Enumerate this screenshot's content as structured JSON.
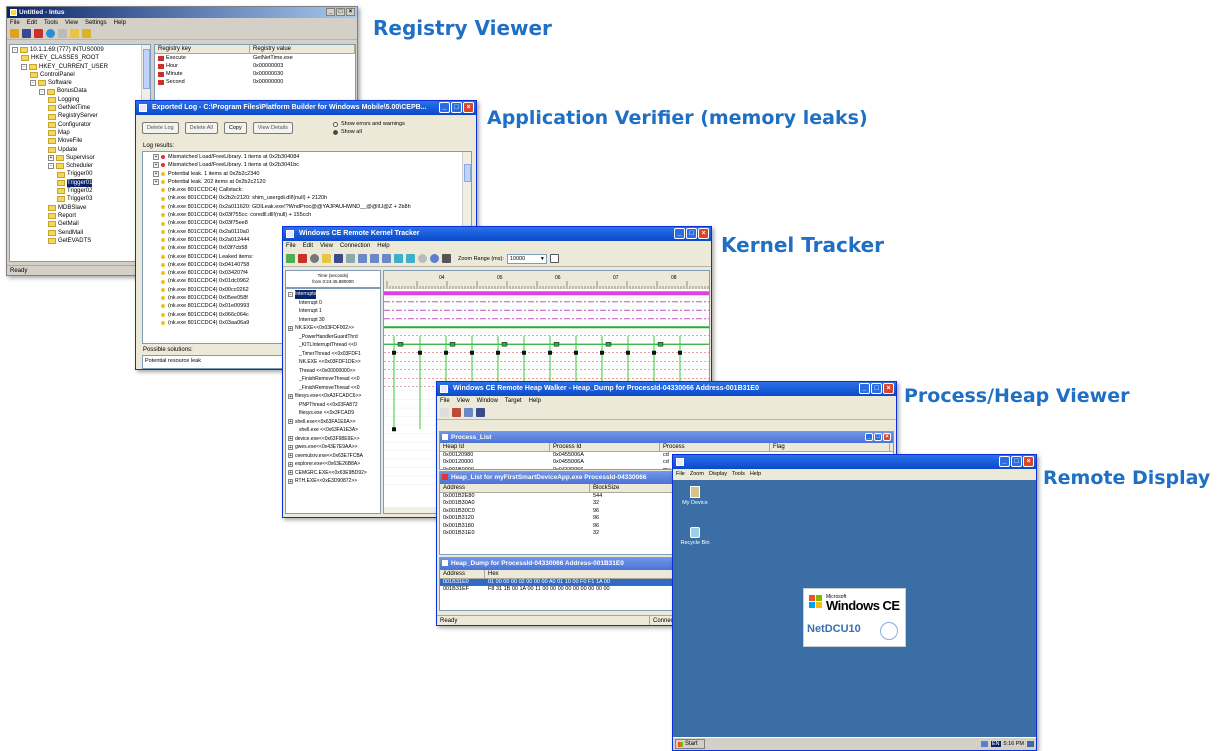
{
  "labels": {
    "registry": "Registry Viewer",
    "verifier": "Application Verifier (memory leaks)",
    "kernel": "Kernel Tracker",
    "heap": "Process/Heap Viewer",
    "remote": "Remote Display"
  },
  "colors": {
    "label_blue": "#1f6fc5",
    "xp_title": "#0a49c9",
    "desktop": "#3a6ea5"
  },
  "registry_window": {
    "title": "Untitled - Intus",
    "menu": [
      "File",
      "Edit",
      "Tools",
      "View",
      "Settings",
      "Help"
    ],
    "tree": [
      {
        "label": "10.1.1.69:(777) INTUS0009",
        "indent": 0,
        "exp": "-"
      },
      {
        "label": "HKEY_CLASSES_ROOT",
        "indent": 1,
        "exp": ""
      },
      {
        "label": "HKEY_CURRENT_USER",
        "indent": 1,
        "exp": "-"
      },
      {
        "label": "ControlPanel",
        "indent": 2,
        "exp": ""
      },
      {
        "label": "Software",
        "indent": 2,
        "exp": "-"
      },
      {
        "label": "BonusData",
        "indent": 3,
        "exp": "-"
      },
      {
        "label": "Logging",
        "indent": 4,
        "exp": ""
      },
      {
        "label": "GetNetTime",
        "indent": 4,
        "exp": ""
      },
      {
        "label": "RegistryServer",
        "indent": 4,
        "exp": ""
      },
      {
        "label": "Configurator",
        "indent": 4,
        "exp": ""
      },
      {
        "label": "Map",
        "indent": 4,
        "exp": ""
      },
      {
        "label": "MoveFile",
        "indent": 4,
        "exp": ""
      },
      {
        "label": "Update",
        "indent": 4,
        "exp": ""
      },
      {
        "label": "Supervisor",
        "indent": 4,
        "exp": "+"
      },
      {
        "label": "Scheduler",
        "indent": 4,
        "exp": "-"
      },
      {
        "label": "Trigger00",
        "indent": 5,
        "exp": ""
      },
      {
        "label": "Trigger01",
        "indent": 5,
        "exp": "",
        "selected": true
      },
      {
        "label": "Trigger02",
        "indent": 5,
        "exp": ""
      },
      {
        "label": "Trigger03",
        "indent": 5,
        "exp": ""
      },
      {
        "label": "MDBSlave",
        "indent": 4,
        "exp": ""
      },
      {
        "label": "Report",
        "indent": 4,
        "exp": ""
      },
      {
        "label": "GetMail",
        "indent": 4,
        "exp": ""
      },
      {
        "label": "SendMail",
        "indent": 4,
        "exp": ""
      },
      {
        "label": "GetEVADTS",
        "indent": 4,
        "exp": ""
      }
    ],
    "columns": [
      "Registry key",
      "Registry value"
    ],
    "values": [
      {
        "key": "Execute",
        "value": "GetNetTime.exe"
      },
      {
        "key": "Hour",
        "value": "0x00000003"
      },
      {
        "key": "Minute",
        "value": "0x00000030"
      },
      {
        "key": "Second",
        "value": "0x00000000"
      }
    ],
    "status": "Ready"
  },
  "verifier_window": {
    "title": "Exported Log - C:\\Program Files\\Platform Builder for Windows Mobile\\5.00\\CEPB...",
    "buttons": [
      "Delete Log",
      "Delete All",
      "Copy",
      "View Details"
    ],
    "radio_errors": "Show errors and warnings",
    "radio_all": "Show all",
    "log_label": "Log results:",
    "rows": [
      {
        "text": "Mismatched Load/FreeLibrary.   1 items at 0x2b304084",
        "indent": 1,
        "color": "#d33"
      },
      {
        "text": "Mismatched Load/FreeLibrary.   1 items at 0x2b3041bc",
        "indent": 1,
        "color": "#d33"
      },
      {
        "text": "Potential leak.   1 items at 0x2b2c2340",
        "indent": 1,
        "color": "#f0c020"
      },
      {
        "text": "Potential leak.   202 items at 0x2b2c2120",
        "indent": 1,
        "color": "#f0c020"
      },
      {
        "text": "(nk.exe 801CCDC4) Callstack:",
        "indent": 2,
        "color": "#f0c020"
      },
      {
        "text": "(nk.exe 801CCDC4)   0x2b2c2120: shim_usergdi.dll!(null) + 2120h",
        "indent": 2,
        "color": "#f0c020"
      },
      {
        "text": "(nk.exe 801CCDC4)   0x2a011620: GDILeak.exe!?WndProc@@YAJPAUHWND__@@IIJ@Z + 2b8h",
        "indent": 2,
        "color": "#f0c020"
      },
      {
        "text": "(nk.exe 801CCDC4)   0x03f755cc: coredll.dll!(null) + 155cch",
        "indent": 2,
        "color": "#f0c020"
      },
      {
        "text": "(nk.exe 801CCDC4)   0x03f75ee8",
        "indent": 2,
        "color": "#f0c020"
      },
      {
        "text": "(nk.exe 801CCDC4)   0x2a0110a0",
        "indent": 2,
        "color": "#f0c020"
      },
      {
        "text": "(nk.exe 801CCDC4)   0x2a012444",
        "indent": 2,
        "color": "#f0c020"
      },
      {
        "text": "(nk.exe 801CCDC4)   0x03f7cb58",
        "indent": 2,
        "color": "#f0c020"
      },
      {
        "text": "(nk.exe 801CCDC4) Leaked items:",
        "indent": 2,
        "color": "#f0c020"
      },
      {
        "text": "(nk.exe 801CCDC4)   0x04140758",
        "indent": 2,
        "color": "#f0c020"
      },
      {
        "text": "(nk.exe 801CCDC4)   0x034207f4",
        "indent": 2,
        "color": "#f0c020"
      },
      {
        "text": "(nk.exe 801CCDC4)   0x01dc0962",
        "indent": 2,
        "color": "#f0c020"
      },
      {
        "text": "(nk.exe 801CCDC4)   0x00cc0262",
        "indent": 2,
        "color": "#f0c020"
      },
      {
        "text": "(nk.exe 801CCDC4)   0x05ee058f",
        "indent": 2,
        "color": "#f0c020"
      },
      {
        "text": "(nk.exe 801CCDC4)   0x01e00993",
        "indent": 2,
        "color": "#f0c020"
      },
      {
        "text": "(nk.exe 801CCDC4)   0x066c064c",
        "indent": 2,
        "color": "#f0c020"
      },
      {
        "text": "(nk.exe 801CCDC4)   0x03aa06a9",
        "indent": 2,
        "color": "#f0c020"
      }
    ],
    "solutions_label": "Possible solutions:",
    "solutions_text": "Potential resource leak"
  },
  "kernel_window": {
    "title": "Windows CE Remote Kernel Tracker",
    "menu": [
      "File",
      "Edit",
      "View",
      "Connection",
      "Help"
    ],
    "zoom_label": "Zoom Range (ms):",
    "zoom_value": "10000",
    "time_label": "Time (seconds)",
    "time_sub": "from 0:24:45.880000",
    "ticks": [
      "04",
      "05",
      "06",
      "07",
      "08"
    ],
    "tree": [
      {
        "text": "Interrupts",
        "indent": 0,
        "sel": true
      },
      {
        "text": "Interrupt 0",
        "indent": 1
      },
      {
        "text": "Interrupt 1",
        "indent": 1
      },
      {
        "text": "Interrupt 30",
        "indent": 1
      },
      {
        "text": "NK.EXE<<0x03FDF002>>",
        "indent": 0
      },
      {
        "text": "_PowerHandlerGuardThrd",
        "indent": 1
      },
      {
        "text": "_KITLInterruptThread <<0",
        "indent": 1
      },
      {
        "text": "_TimerThread <<0x03FDF1",
        "indent": 1
      },
      {
        "text": "NK.EXE <<0x03FDF1DE>>",
        "indent": 1
      },
      {
        "text": "Thread <<0x00000000>>",
        "indent": 1
      },
      {
        "text": "_FinishRemoveThread <<0",
        "indent": 1
      },
      {
        "text": "_FinishRemoveThread <<0",
        "indent": 1
      },
      {
        "text": "filesys.exe<<0xA3FCADC6>>",
        "indent": 0
      },
      {
        "text": "PNPThread <<0x03FA872",
        "indent": 1
      },
      {
        "text": "filesys.exe <<0x3FCAD9",
        "indent": 1
      },
      {
        "text": "shell.exe<<0x63FA1E6A>>",
        "indent": 0
      },
      {
        "text": "shell.exe <<0x63FA1E3A>",
        "indent": 1
      },
      {
        "text": "device.exe<<0x63F98E9E>>",
        "indent": 0
      },
      {
        "text": "gwes.exe<<0x43E7E9AA>>",
        "indent": 0
      },
      {
        "text": "ceemulsrv.exe<<0x63E7FCBA",
        "indent": 0
      },
      {
        "text": "explorer.exe<<0x63E26B8A>",
        "indent": 0
      },
      {
        "text": "CEMGRC.EXE<<0x63E9BD92>",
        "indent": 0
      },
      {
        "text": "RTH.EXE<<0xE3D90872>>",
        "indent": 0
      }
    ]
  },
  "heap_window": {
    "title": "Windows CE Remote Heap Walker - Heap_Dump for ProcessId-04330066 Address-001B31E0",
    "menu": [
      "File",
      "View",
      "Window",
      "Target",
      "Help"
    ],
    "process_list_title": "Process_List",
    "process_columns": [
      "Heap Id",
      "Process Id",
      "Process",
      "Flag"
    ],
    "process_rows": [
      [
        "0x00120980",
        "0x0455006A",
        "cd",
        ""
      ],
      [
        "0x00120000",
        "0x0455006A",
        "cd",
        ""
      ],
      [
        "0x001B0000",
        "0x04330066",
        "my",
        ""
      ]
    ],
    "heap_list_title": "Heap_List for myFirstSmartDeviceApp.exe ProcessId-04330066",
    "heap_columns": [
      "Address",
      "BlockSize"
    ],
    "heap_rows": [
      [
        "0x001B2E80",
        "544"
      ],
      [
        "0x001B30A0",
        "32"
      ],
      [
        "0x001B30C0",
        "96"
      ],
      [
        "0x001B3120",
        "96"
      ],
      [
        "0x001B3180",
        "96"
      ],
      [
        "0x001B31E0",
        "32"
      ]
    ],
    "dump_title": "Heap_Dump for ProcessId-04330066 Address-001B31E0",
    "dump_columns": [
      "Address",
      "Hex"
    ],
    "dump_rows": [
      [
        "001B31E0",
        "01 00 00 00 02 00 00 00 A0 01 10 00 F0 F1 1A 00",
        true
      ],
      [
        "001B31EF",
        "F8 31 1B 00 1A 00 11 00 00 00 00 00 00 00 00 00",
        false
      ]
    ],
    "status": "Ready",
    "status_right": "Connecti"
  },
  "remote_window": {
    "title": "",
    "menu": [
      "File",
      "Zoom",
      "Display",
      "Tools",
      "Help"
    ],
    "icon_device": "My Device",
    "icon_recycle": "Recycle Bin",
    "logo_small": "Microsoft",
    "logo_text": "Windows CE",
    "logo_sub": "NetDCU10",
    "start": "Start",
    "clock": "5:16 PM",
    "lang": "EN"
  }
}
